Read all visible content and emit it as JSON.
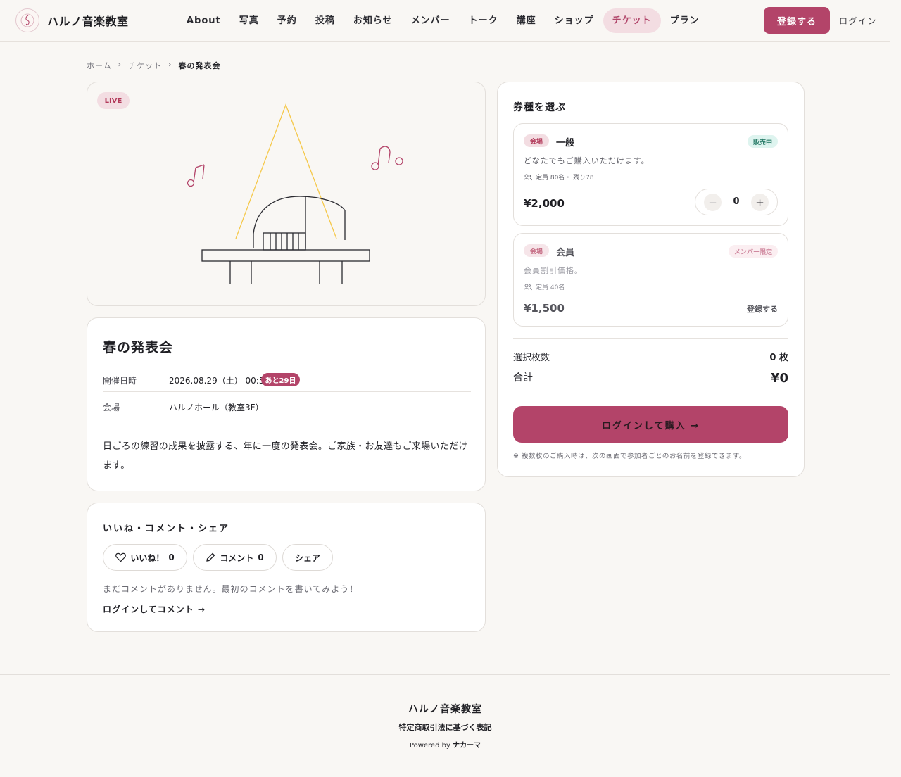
{
  "header": {
    "brand": "ハルノ音楽教室",
    "nav": [
      "About",
      "写真",
      "予約",
      "投稿",
      "お知らせ",
      "メンバー",
      "トーク",
      "講座",
      "ショップ",
      "チケット",
      "プラン"
    ],
    "active_nav": "チケット",
    "register_label": "登録する",
    "login_label": "ログイン"
  },
  "breadcrumb": {
    "home": "ホーム",
    "sep": "›",
    "tickets": "チケット",
    "current": "春の発表会"
  },
  "hero": {
    "badge": "LIVE"
  },
  "event": {
    "title": "春の発表会",
    "date_label": "開催日時",
    "date_value": "2026.08.29（土） 00:51",
    "days_left": "あと29日",
    "venue_label": "会場",
    "venue_value": "ハルノホール（教室3F）",
    "description": "日ごろの練習の成果を披露する、年に一度の発表会。ご家族・お友達もご来場いただけます。"
  },
  "social": {
    "title": "いいね・コメント・シェア",
    "like_label": "いいね！",
    "like_count": "0",
    "comment_label": "コメント",
    "comment_count": "0",
    "share_label": "シェア",
    "empty_text": "まだコメントがありません。最初のコメントを書いてみよう！",
    "login_comment": "ログインしてコメント →"
  },
  "tickets": {
    "title": "券種を選ぶ",
    "items": [
      {
        "venue_badge": "会場",
        "name": "一般",
        "status": "販売中",
        "description": "どなたでもご購入いただけます。",
        "capacity": "定員 80名・ 残り78",
        "price": "¥2,000",
        "quantity": "0",
        "minus": "−",
        "plus": "+"
      },
      {
        "venue_badge": "会場",
        "name": "会員",
        "status": "メンバー限定",
        "description": "会員割引価格。",
        "capacity": "定員 40名",
        "price": "¥1,500",
        "action": "登録する"
      }
    ],
    "count_label": "選択枚数",
    "count_value": "0 枚",
    "total_label": "合計",
    "total_value": "¥0",
    "buy_label": "ログインして購入 →",
    "note": "※ 複数枚のご購入時は、次の画面で参加者ごとのお名前を登録できます。"
  },
  "footer": {
    "brand": "ハルノ音楽教室",
    "law": "特定商取引法に基づく表記",
    "powered_prefix": "Powered by",
    "powered_brand": "ナカーマ"
  },
  "colors": {
    "accent": "#b34469",
    "accent_soft": "#f3dde2",
    "status_green_bg": "#def4ef",
    "status_green_fg": "#2e7f6c",
    "background": "#f9f7f4"
  }
}
